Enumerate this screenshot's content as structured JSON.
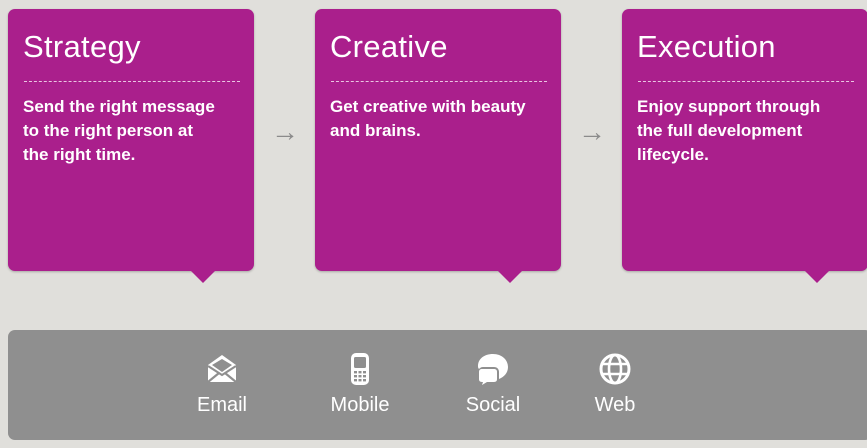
{
  "stages": [
    {
      "title": "Strategy",
      "description": "Send the right message to the right person at the right time."
    },
    {
      "title": "Creative",
      "description": "Get creative with beauty and brains."
    },
    {
      "title": "Execution",
      "description": "Enjoy support through the full development lifecycle."
    }
  ],
  "arrow_glyph": "→",
  "channels": [
    {
      "label": "Email",
      "icon": "envelope-icon"
    },
    {
      "label": "Mobile",
      "icon": "mobile-phone-icon"
    },
    {
      "label": "Social",
      "icon": "speech-bubbles-icon"
    },
    {
      "label": "Web",
      "icon": "globe-icon"
    }
  ],
  "colors": {
    "background": "#e0dfdb",
    "card": "#aa1f8c",
    "channel_bar": "#8f8f8f",
    "arrow": "#8b8b8b",
    "text": "#ffffff"
  }
}
